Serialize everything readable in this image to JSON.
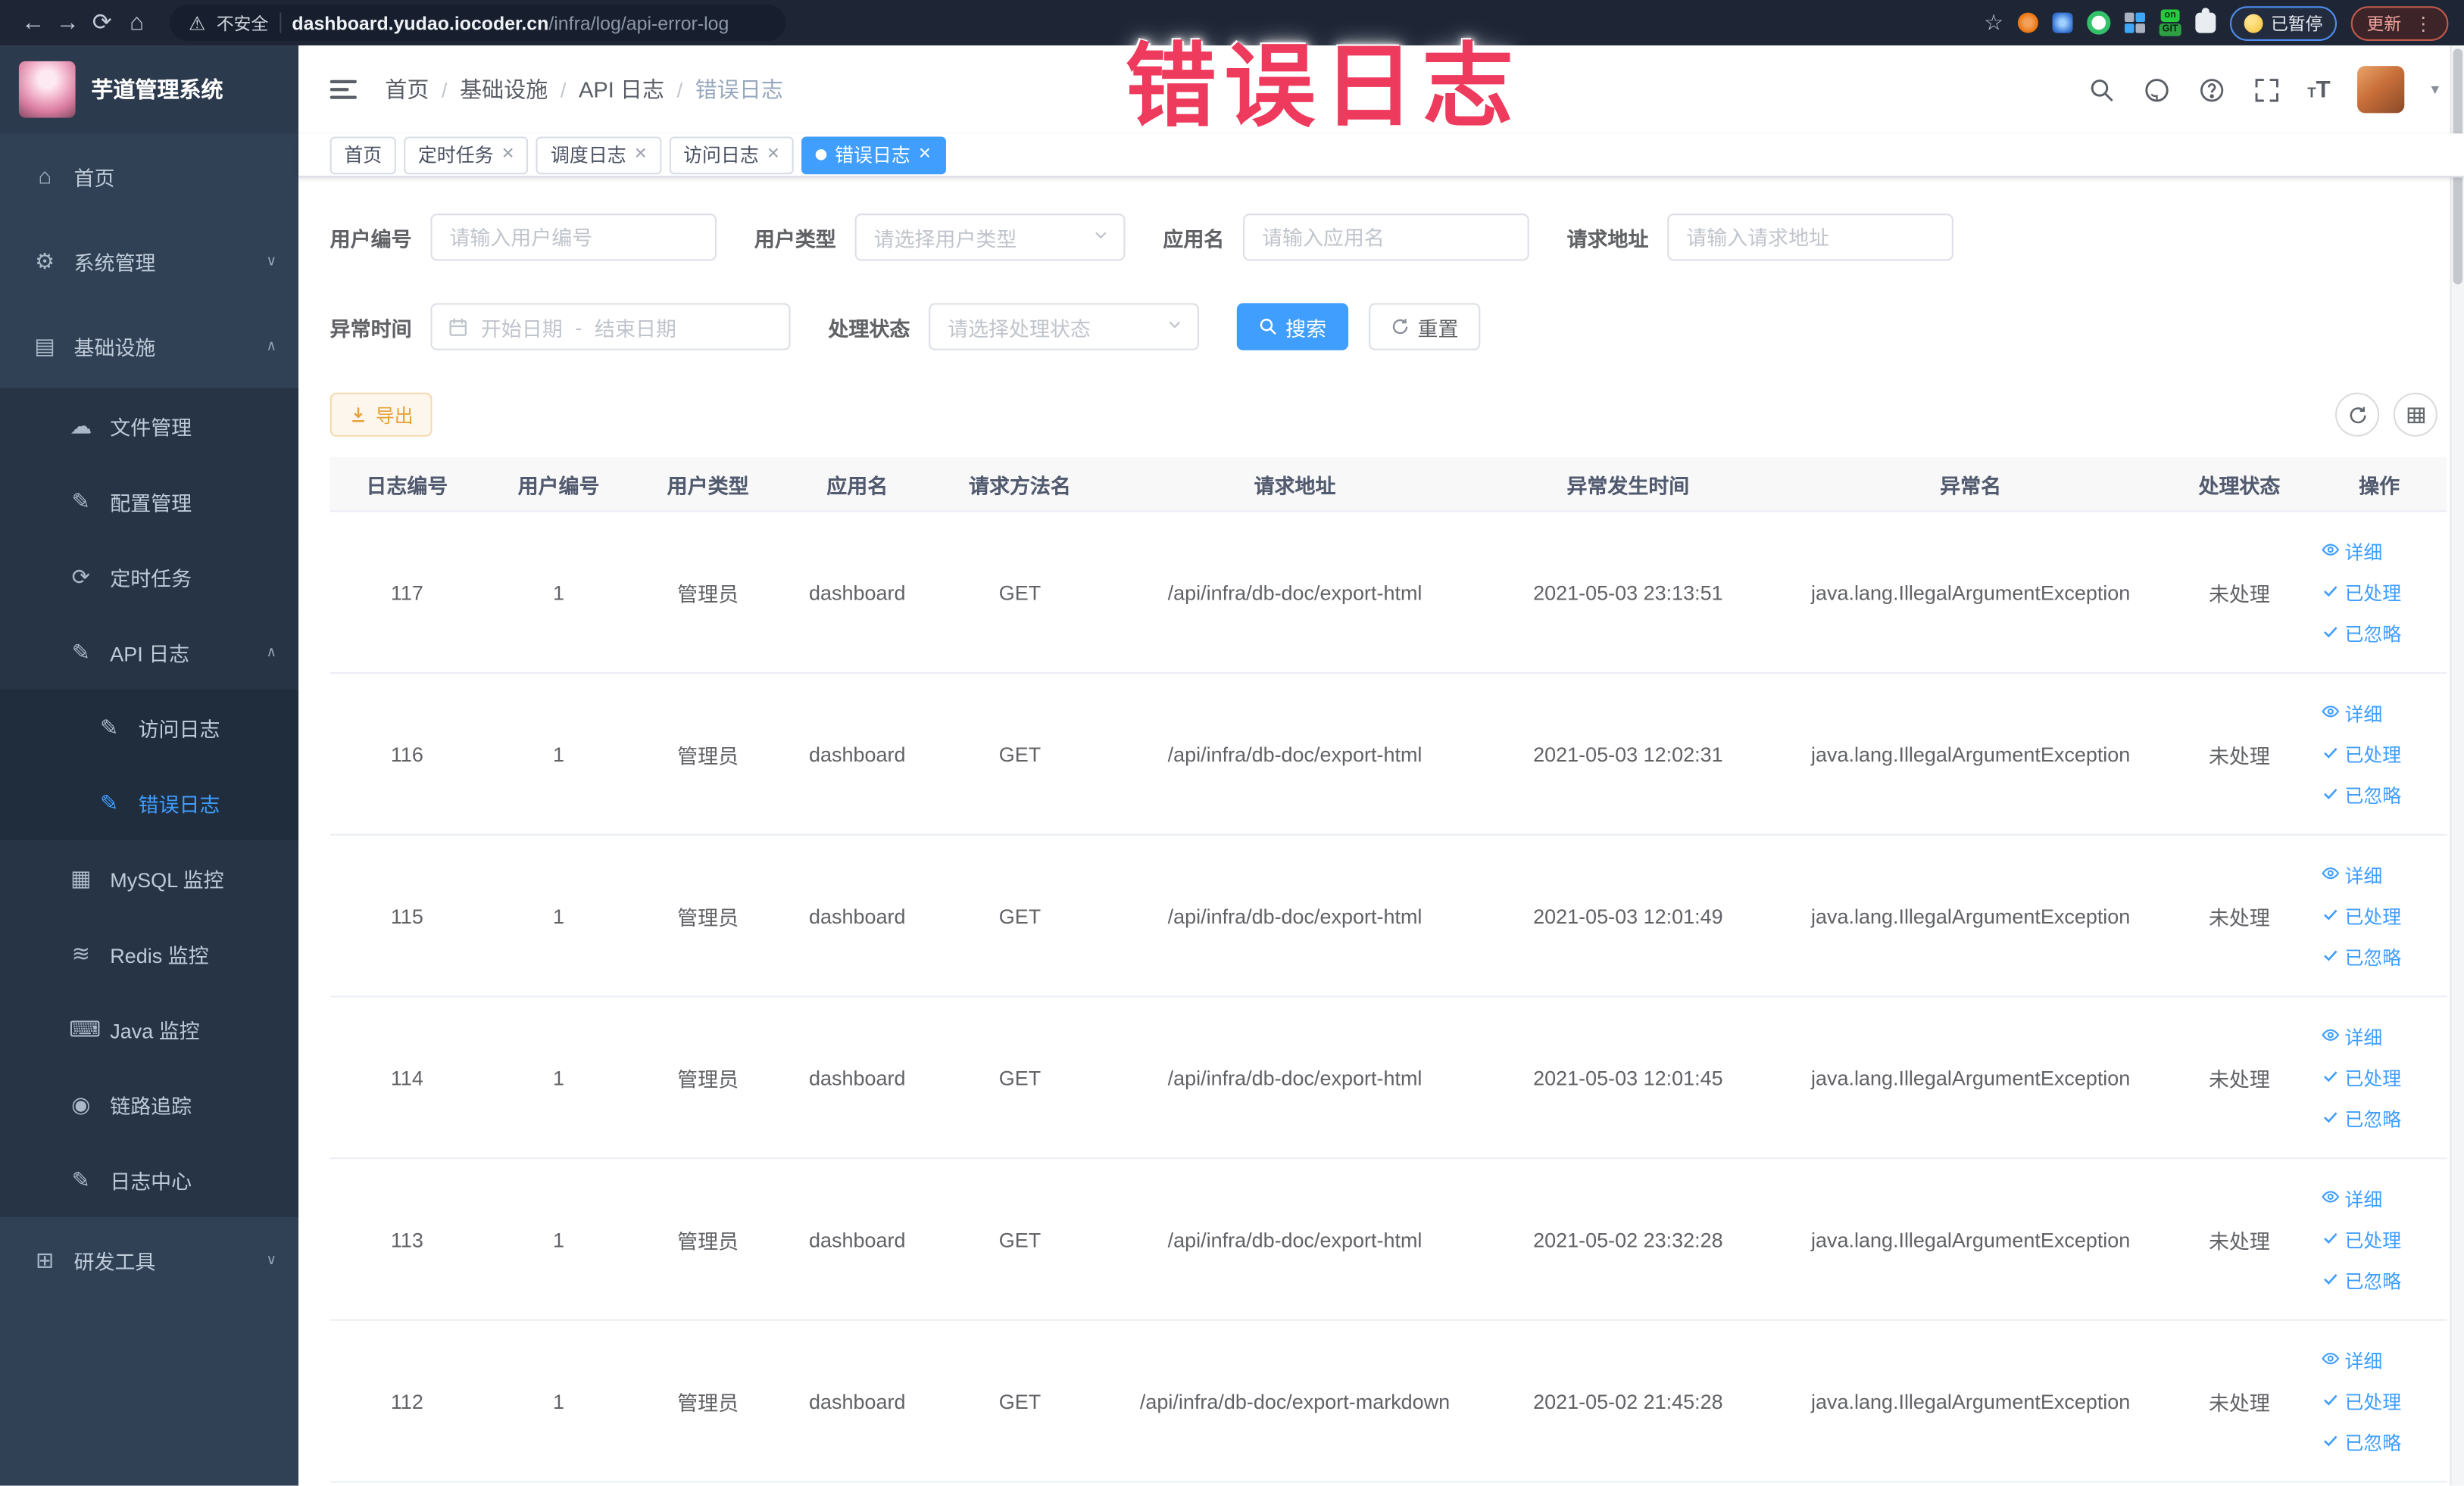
{
  "browser": {
    "nav_icons": [
      "back-icon",
      "forward-icon",
      "reload-icon",
      "home-icon"
    ],
    "security_text": "不安全",
    "url_domain": "dashboard.yudao.iocoder.cn",
    "url_path": "/infra/log/api-error-log",
    "extension_icons": [
      "bookmark-star-icon",
      "extension-orange-icon",
      "extension-blue-icon",
      "extension-green-icon",
      "extension-grid-icon",
      "puzzle-icon"
    ],
    "git_badge": "GIT",
    "on_badge": "on",
    "paused_label": "已暂停",
    "update_label": "更新"
  },
  "watermark": "错误日志",
  "header": {
    "logo_title": "芋道管理系统",
    "breadcrumb": [
      "首页",
      "基础设施",
      "API 日志",
      "错误日志"
    ],
    "icons": [
      "search-icon",
      "github-icon",
      "help-icon",
      "fullscreen-icon",
      "text-size-icon"
    ]
  },
  "tabs": [
    {
      "id": "home",
      "label": "首页",
      "closable": false,
      "active": false
    },
    {
      "id": "cron-job",
      "label": "定时任务",
      "closable": true,
      "active": false
    },
    {
      "id": "schedule-log",
      "label": "调度日志",
      "closable": true,
      "active": false
    },
    {
      "id": "access-log",
      "label": "访问日志",
      "closable": true,
      "active": false
    },
    {
      "id": "error-log",
      "label": "错误日志",
      "closable": true,
      "active": true
    }
  ],
  "sidebar": {
    "items": [
      {
        "id": "home",
        "label": "首页",
        "icon": "home-icon",
        "level": 1
      },
      {
        "id": "system-management",
        "label": "系统管理",
        "icon": "gear-icon",
        "level": 1,
        "chevron": "down"
      },
      {
        "id": "infrastructure",
        "label": "基础设施",
        "icon": "infrastructure-icon",
        "level": 1,
        "chevron": "up"
      },
      {
        "id": "file-management",
        "label": "文件管理",
        "icon": "file-upload-icon",
        "level": 2
      },
      {
        "id": "config-management",
        "label": "配置管理",
        "icon": "edit-icon",
        "level": 2
      },
      {
        "id": "cron-job",
        "label": "定时任务",
        "icon": "clock-icon",
        "level": 2
      },
      {
        "id": "api-log",
        "label": "API 日志",
        "icon": "doc-edit-icon",
        "level": 2,
        "chevron": "up"
      },
      {
        "id": "access-log",
        "label": "访问日志",
        "icon": "doc-edit-icon",
        "level": 3
      },
      {
        "id": "error-log",
        "label": "错误日志",
        "icon": "doc-edit-icon",
        "level": 3,
        "active": true
      },
      {
        "id": "mysql-monitor",
        "label": "MySQL 监控",
        "icon": "mysql-icon",
        "level": 2
      },
      {
        "id": "redis-monitor",
        "label": "Redis 监控",
        "icon": "redis-icon",
        "level": 2
      },
      {
        "id": "java-monitor",
        "label": "Java 监控",
        "icon": "java-icon",
        "level": 2
      },
      {
        "id": "link-trace",
        "label": "链路追踪",
        "icon": "trace-eye-icon",
        "level": 2
      },
      {
        "id": "log-center",
        "label": "日志中心",
        "icon": "doc-edit-icon",
        "level": 2
      },
      {
        "id": "dev-tools",
        "label": "研发工具",
        "icon": "toolbox-icon",
        "level": 1,
        "chevron": "down"
      }
    ]
  },
  "filters": {
    "user_id": {
      "label": "用户编号",
      "placeholder": "请输入用户编号"
    },
    "user_type": {
      "label": "用户类型",
      "placeholder": "请选择用户类型"
    },
    "app_name": {
      "label": "应用名",
      "placeholder": "请输入应用名"
    },
    "request_url": {
      "label": "请求地址",
      "placeholder": "请输入请求地址"
    },
    "exception_time": {
      "label": "异常时间",
      "start_placeholder": "开始日期",
      "separator": "-",
      "end_placeholder": "结束日期"
    },
    "process_status": {
      "label": "处理状态",
      "placeholder": "请选择处理状态"
    },
    "search_button": "搜索",
    "reset_button": "重置"
  },
  "toolbar": {
    "export_label": "导出",
    "icon_buttons": [
      "refresh-icon",
      "column-settings-icon"
    ]
  },
  "table": {
    "columns": [
      "日志编号",
      "用户编号",
      "用户类型",
      "应用名",
      "请求方法名",
      "请求地址",
      "异常发生时间",
      "异常名",
      "处理状态",
      "操作"
    ],
    "rows": [
      {
        "id": "117",
        "user_id": "1",
        "user_type": "管理员",
        "app_name": "dashboard",
        "method": "GET",
        "url": "/api/infra/db-doc/export-html",
        "time": "2021-05-03 23:13:51",
        "exception": "java.lang.IllegalArgumentException",
        "status": "未处理"
      },
      {
        "id": "116",
        "user_id": "1",
        "user_type": "管理员",
        "app_name": "dashboard",
        "method": "GET",
        "url": "/api/infra/db-doc/export-html",
        "time": "2021-05-03 12:02:31",
        "exception": "java.lang.IllegalArgumentException",
        "status": "未处理"
      },
      {
        "id": "115",
        "user_id": "1",
        "user_type": "管理员",
        "app_name": "dashboard",
        "method": "GET",
        "url": "/api/infra/db-doc/export-html",
        "time": "2021-05-03 12:01:49",
        "exception": "java.lang.IllegalArgumentException",
        "status": "未处理"
      },
      {
        "id": "114",
        "user_id": "1",
        "user_type": "管理员",
        "app_name": "dashboard",
        "method": "GET",
        "url": "/api/infra/db-doc/export-html",
        "time": "2021-05-03 12:01:45",
        "exception": "java.lang.IllegalArgumentException",
        "status": "未处理"
      },
      {
        "id": "113",
        "user_id": "1",
        "user_type": "管理员",
        "app_name": "dashboard",
        "method": "GET",
        "url": "/api/infra/db-doc/export-html",
        "time": "2021-05-02 23:32:28",
        "exception": "java.lang.IllegalArgumentException",
        "status": "未处理"
      },
      {
        "id": "112",
        "user_id": "1",
        "user_type": "管理员",
        "app_name": "dashboard",
        "method": "GET",
        "url": "/api/infra/db-doc/export-markdown",
        "time": "2021-05-02 21:45:28",
        "exception": "java.lang.IllegalArgumentException",
        "status": "未处理"
      }
    ],
    "actions": [
      {
        "id": "detail",
        "label": "详细",
        "icon": "eye-icon"
      },
      {
        "id": "processed",
        "label": "已处理",
        "icon": "check-icon"
      },
      {
        "id": "ignored",
        "label": "已忽略",
        "icon": "check-icon"
      }
    ]
  },
  "colors": {
    "primary": "#409eff",
    "warning": "#e6a23c",
    "watermark_red": "#ee3a5c",
    "sidebar_bg": "#304156",
    "sidebar_submenu_bg": "#263445",
    "sidebar_nested_bg": "#1f2d3d",
    "table_header_bg": "#f8f8f9"
  }
}
